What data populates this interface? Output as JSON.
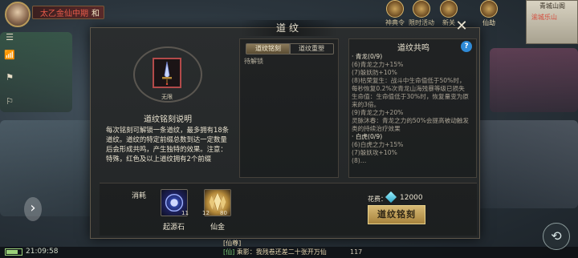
{
  "hud": {
    "player_name": "太乙金仙中期",
    "player_tag": "和",
    "buttons": [
      "神典令",
      "限时活动",
      "新关",
      "仙劫"
    ],
    "minimap_title": "青城山阁",
    "minimap_sub": "渝城乐山"
  },
  "modal": {
    "title": "道纹",
    "left": {
      "gem_label": "无限",
      "desc_title": "道纹铭刻说明",
      "desc_text_before": "每次铭刻可解锁一条道纹，最多拥有18条道纹。道纹的特定前缀总数到达一定数量后会形成共鸣，产生独特的效果。注意：",
      "desc_highlight": "",
      "desc_text_after": "特殊，红色及以上道纹拥有2个前缀"
    },
    "middle": {
      "tabs": [
        "道纹铭刻",
        "道纹重塑"
      ],
      "pending_label": "待解锁"
    },
    "right": {
      "title": "道纹共鸣",
      "help": "?",
      "lines": [
        {
          "text": "· 青龙(0/9)",
          "cls": "head"
        },
        {
          "text": "(6)青龙之力+15%",
          "cls": "muted"
        },
        {
          "text": "(7)躲妖防+10%",
          "cls": "muted"
        },
        {
          "text": "(8)枯荣复生：战斗中生命值低于50%时，每秒恢复0.2%次青龙山海残暴等级已损失生命值：生命值低于30%时，恢复量变为原来的3倍。",
          "cls": "muted"
        },
        {
          "text": "(9)青龙之力+20%",
          "cls": "muted"
        },
        {
          "text": "灵脉沐春：青龙之力的50%会提高被动触发类的持续治疗效果",
          "cls": "muted"
        },
        {
          "text": "· 白虎(0/9)",
          "cls": "head"
        },
        {
          "text": "(6)白虎之力+15%",
          "cls": "muted"
        },
        {
          "text": "(7)躲妖攻+10%",
          "cls": "muted"
        },
        {
          "text": "(8)…",
          "cls": "muted"
        }
      ]
    },
    "bottom": {
      "cost_label": "消耗",
      "items": [
        {
          "name": "起源石",
          "count": "1",
          "have": "11"
        },
        {
          "name": "仙金",
          "count": "80",
          "have": "12"
        }
      ],
      "fee_label": "花费：",
      "fee_value": "12000",
      "engrave_label": "道纹铭刻"
    }
  },
  "bottom_bar": {
    "clock": "21:09:58",
    "chat_line_1_prefix": "[仙尊]",
    "chat_line_1_name": "",
    "chat_line_2_channel": "[仙]",
    "chat_line_2_text": "乘影：我残卷还差二十张开万仙",
    "mail_count": "117"
  },
  "colors": {
    "accent_gold": "#d7b974",
    "red_highlight": "#e85a4a",
    "help_blue": "#2f8ad6"
  }
}
